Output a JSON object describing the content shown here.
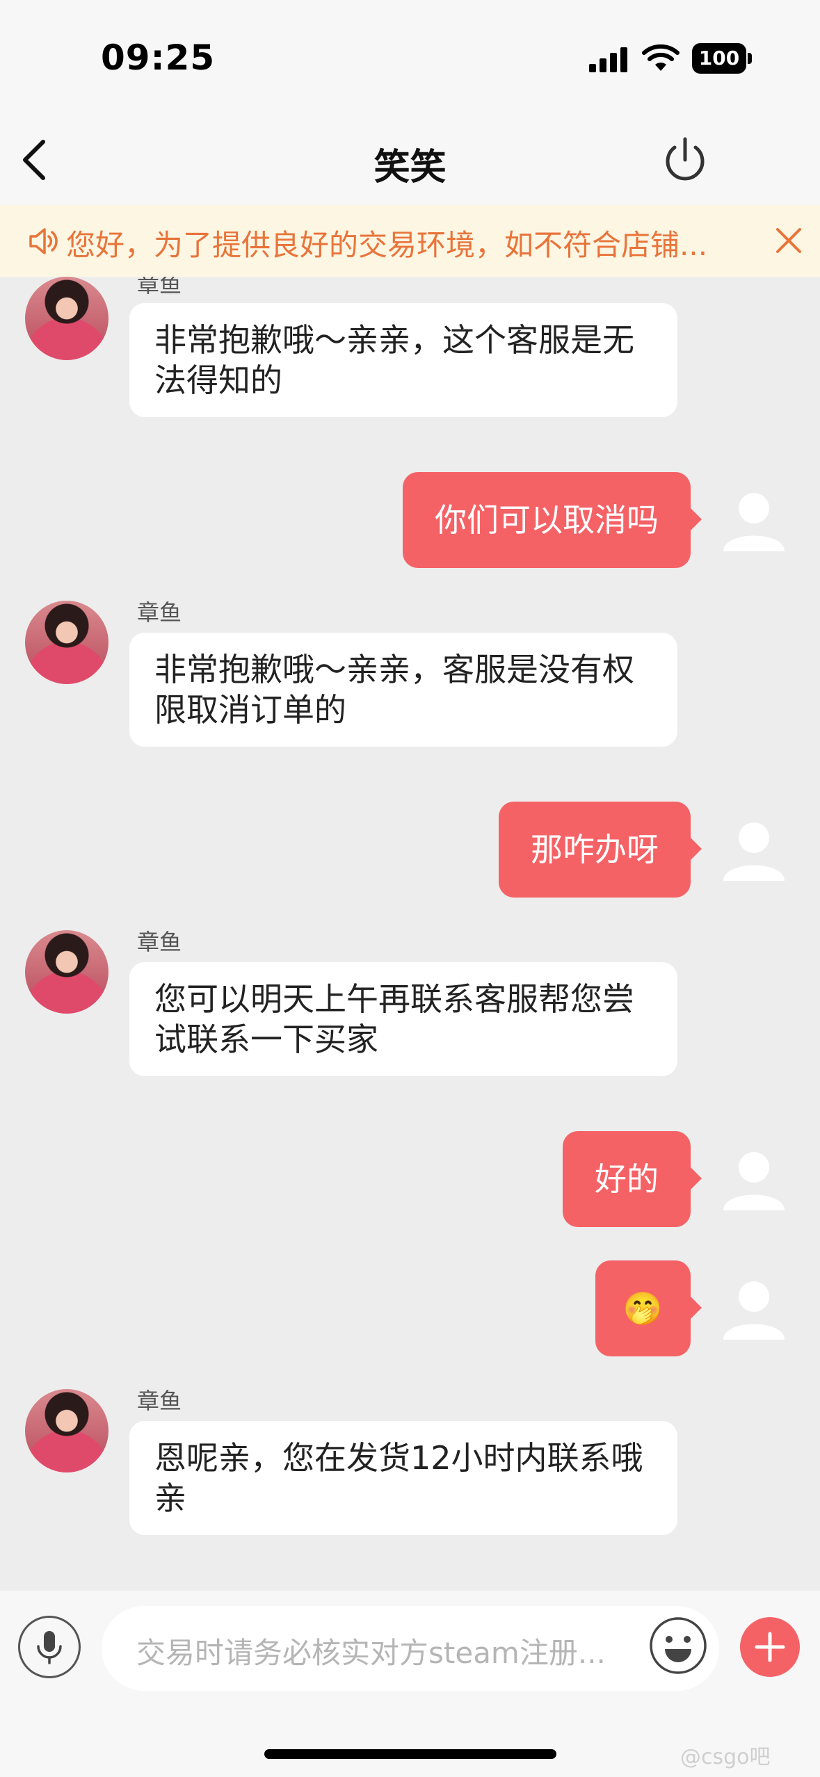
{
  "status_bar": {
    "time": "09:25",
    "battery": "100"
  },
  "nav": {
    "title": "笑笑"
  },
  "notice": {
    "text": "您好，为了提供良好的交易环境，如不符合店铺..."
  },
  "messages": [
    {
      "side": "left",
      "sender": "章鱼",
      "text": "非常抱歉哦～亲亲，这个客服是无法得知的"
    },
    {
      "side": "right",
      "text": "你们可以取消吗"
    },
    {
      "side": "left",
      "sender": "章鱼",
      "text": "非常抱歉哦～亲亲，客服是没有权限取消订单的"
    },
    {
      "side": "right",
      "text": "那咋办呀"
    },
    {
      "side": "left",
      "sender": "章鱼",
      "text": "您可以明天上午再联系客服帮您尝试联系一下买家"
    },
    {
      "side": "right",
      "text": "好的"
    },
    {
      "side": "right",
      "text": "🤭"
    },
    {
      "side": "left",
      "sender": "章鱼",
      "text": "恩呢亲，您在发货12小时内联系哦亲"
    }
  ],
  "input": {
    "placeholder": "交易时请务必核实对方steam注册..."
  },
  "watermark": "@csgo吧",
  "colors": {
    "accent": "#f56266",
    "notice_text": "#e8743a",
    "notice_bg": "#fdf6e3",
    "chat_bg": "#ededed"
  }
}
